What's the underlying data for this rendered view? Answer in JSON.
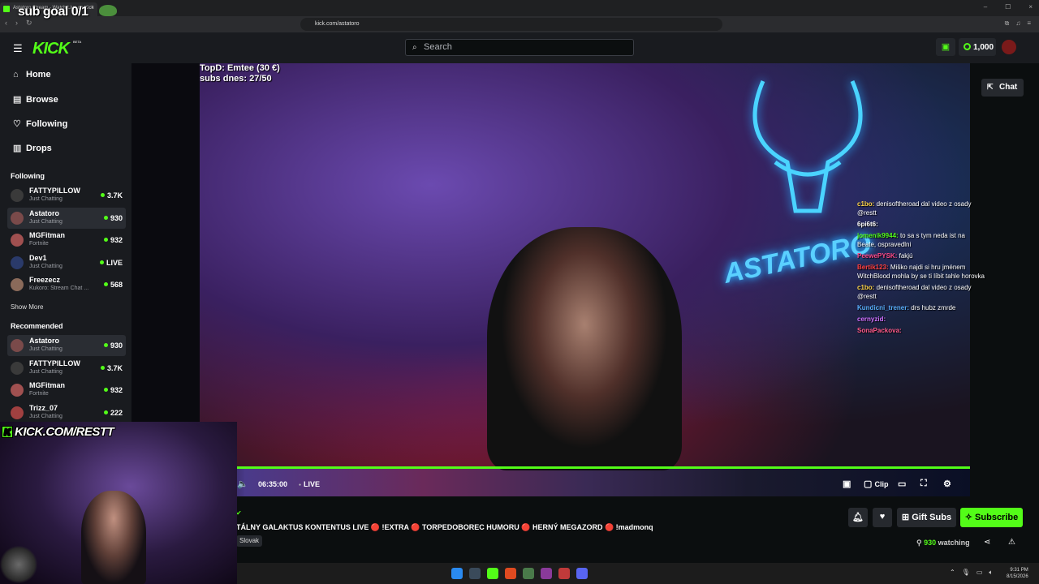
{
  "browser": {
    "tab_title": "Astatoro Stream - Watch Live on Kick",
    "tab_close": "×",
    "url": "kick.com/astatoro",
    "window_controls": [
      "–",
      "☐",
      "×"
    ]
  },
  "overlay": {
    "sub_goal": "sub goal 0/1",
    "kick_banner": "KICK.COM/RESTT",
    "topd_line1": "TopD: Emtee (30 €)",
    "topd_line2": "subs dnes: 27/50"
  },
  "header": {
    "logo": "KICK",
    "beta": "BETA",
    "search_placeholder": "Search",
    "points": "1,000"
  },
  "sidebar": {
    "nav": [
      {
        "label": "Home",
        "icon": "home-icon"
      },
      {
        "label": "Browse",
        "icon": "browse-icon"
      },
      {
        "label": "Following",
        "icon": "heart-icon"
      },
      {
        "label": "Drops",
        "icon": "drops-icon"
      }
    ],
    "following_heading": "Following",
    "following": [
      {
        "name": "FATTYPILLOW",
        "category": "Just Chatting",
        "viewers": "3.7K",
        "avatar_color": "#3a3a3a"
      },
      {
        "name": "Astatoro",
        "category": "Just Chatting",
        "viewers": "930",
        "avatar_color": "#7a4a4a"
      },
      {
        "name": "MGFitman",
        "category": "Fortnite",
        "viewers": "932",
        "avatar_color": "#a05050"
      },
      {
        "name": "Dev1",
        "category": "Just Chatting",
        "viewers": "LIVE",
        "avatar_color": "#2a3a6a"
      },
      {
        "name": "Freezecz",
        "category": "Kukoro: Stream Chat ...",
        "viewers": "568",
        "avatar_color": "#8a6a5a"
      }
    ],
    "show_more": "Show More",
    "recommended_heading": "Recommended",
    "recommended": [
      {
        "name": "Astatoro",
        "category": "Just Chatting",
        "viewers": "930",
        "avatar_color": "#7a4a4a"
      },
      {
        "name": "FATTYPILLOW",
        "category": "Just Chatting",
        "viewers": "3.7K",
        "avatar_color": "#3a3a3a"
      },
      {
        "name": "MGFitman",
        "category": "Fortnite",
        "viewers": "932",
        "avatar_color": "#a05050"
      },
      {
        "name": "Trizz_07",
        "category": "Just Chatting",
        "viewers": "222",
        "avatar_color": "#a04040"
      }
    ]
  },
  "player": {
    "neon_text": "ASTATORO",
    "chat_button": "Chat",
    "time": "06:35:00",
    "live": "LIVE",
    "clip": "Clip",
    "chat_overlay": [
      {
        "user": "c1bo:",
        "user_color": "#ffd54a",
        "text": "denisoftheroad dal video z osady @restt"
      },
      {
        "user": "6pi6t6:",
        "user_color": "#ffffff",
        "text": ""
      },
      {
        "user": "jomenik9944:",
        "user_color": "#53fc18",
        "text": "to sa s tym neda ist na Beate, ospravedlni"
      },
      {
        "user": "PeewePYSK:",
        "user_color": "#ff4a8a",
        "text": "fakjú"
      },
      {
        "user": "Bertik123:",
        "user_color": "#ff4040",
        "text": "Miško najdi si hru jménem WitchBlood mohla by se ti líbit tahle horovka"
      },
      {
        "user": "c1bo:",
        "user_color": "#ffd54a",
        "text": "denisoftheroad dal video z osady @restt"
      },
      {
        "user": "Kundicni_trener:",
        "user_color": "#5ab0ff",
        "text": "drs hubz zmrde"
      },
      {
        "user": "cernyzid:",
        "user_color": "#d070ff",
        "text": ""
      },
      {
        "user": "SonaPackova:",
        "user_color": "#ff5a8a",
        "text": ""
      }
    ]
  },
  "stream": {
    "title": "TÁLNY GALAKTUS KONTENTUS LIVE 🔴 !EXTRA 🔴 TORPEDOBOREC HUMORU 🔴 HERNÝ MEGAZORD 🔴 !madmonq",
    "language": "Slovak",
    "gift_subs": "Gift Subs",
    "subscribe": "Subscribe",
    "watching_count": "930",
    "watching_label": "watching"
  },
  "taskbar": {
    "time": "9:31 PM",
    "date": "8/15/2026"
  },
  "colors": {
    "accent": "#53fc18",
    "panel": "#191b1f",
    "background": "#0b0e0f"
  }
}
